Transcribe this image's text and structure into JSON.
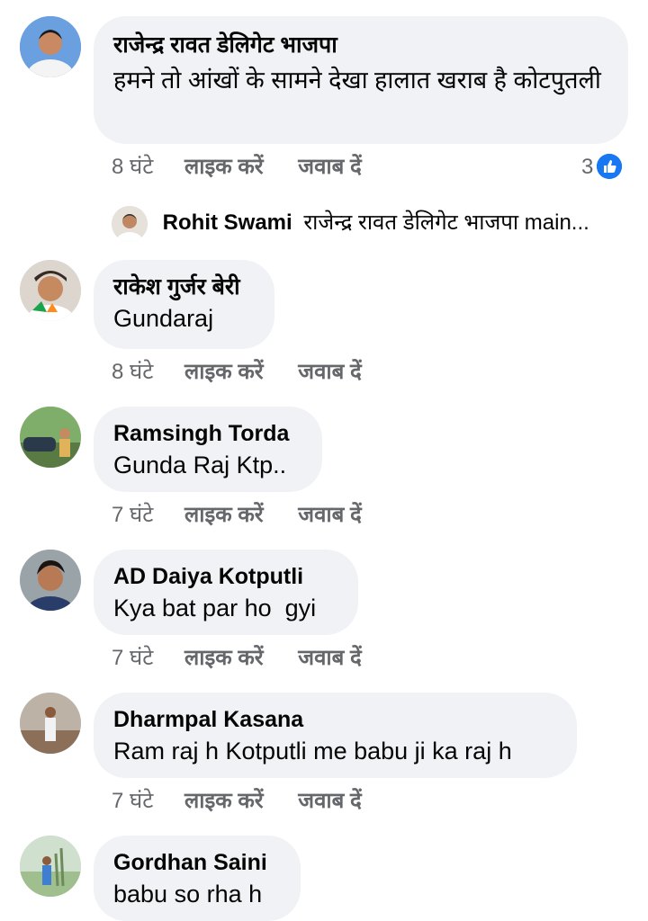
{
  "comments": [
    {
      "name": "राजेन्द्र रावत डेलिगेट भाजपा",
      "text": "हमने तो आंखों के सामने देखा हालात खराब है कोटपुतली",
      "time": "8 घंटे",
      "like": "लाइक करें",
      "reply": "जवाब दें",
      "reaction_count": "3",
      "reply_preview": {
        "name": "Rohit Swami",
        "text": "राजेन्द्र रावत डेलिगेट भाजपा  main..."
      }
    },
    {
      "name": "राकेश गुर्जर बेरी",
      "text": "Gundaraj",
      "time": "8 घंटे",
      "like": "लाइक करें",
      "reply": "जवाब दें"
    },
    {
      "name": "Ramsingh Torda",
      "text": "Gunda Raj Ktp..",
      "time": "7 घंटे",
      "like": "लाइक करें",
      "reply": "जवाब दें"
    },
    {
      "name": "AD Daiya Kotputli",
      "text": "Kya bat par ho  gyi",
      "time": "7 घंटे",
      "like": "लाइक करें",
      "reply": "जवाब दें"
    },
    {
      "name": "Dharmpal Kasana",
      "text": "Ram raj h Kotputli me babu ji ka raj h",
      "time": "7 घंटे",
      "like": "लाइक करें",
      "reply": "जवाब दें"
    },
    {
      "name": "Gordhan Saini",
      "text": "babu so rha h"
    }
  ],
  "colors": {
    "bubble": "#f0f2f5",
    "meta": "#65676b",
    "like_blue": "#1877f2"
  }
}
